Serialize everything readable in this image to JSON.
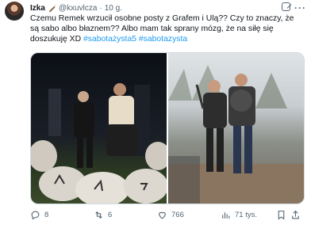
{
  "author": {
    "name": "Izka",
    "handle": "@kxuvlcza",
    "sep": "·",
    "time": "10 g."
  },
  "tweet": {
    "text": "Czemu Remek wrzucił osobne posty z Grafem i Ulą?? Czy to znaczy, że są sabo albo błaznem?? Albo mam tak sprany mózg, że na siłę się doszukuję XD ",
    "hashtags": "#sabotażysta5 #sabotazysta"
  },
  "stats": {
    "replies": "8",
    "reposts": "6",
    "likes": "766",
    "views": "71 tys."
  }
}
